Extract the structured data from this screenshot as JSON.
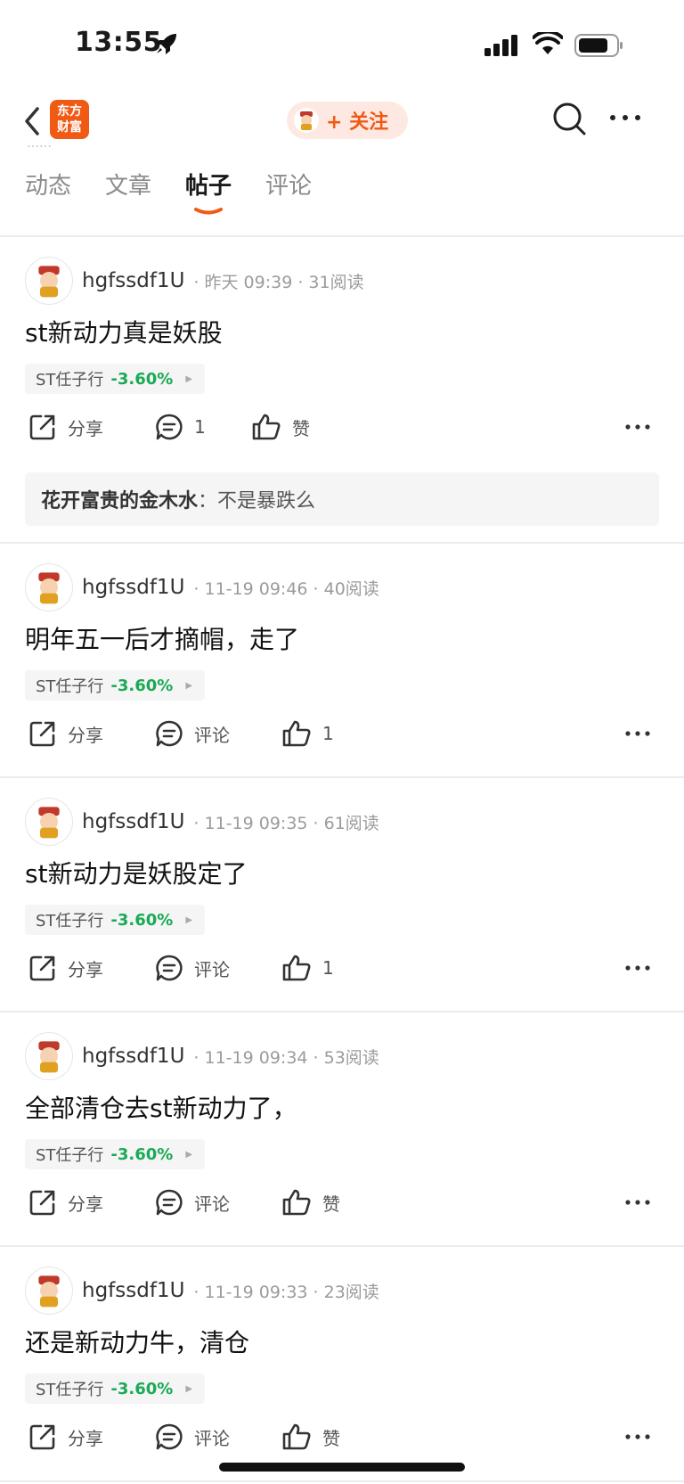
{
  "status_bar": {
    "time": "13:55"
  },
  "nav": {
    "logo_line1": "东方",
    "logo_line2": "财富",
    "follow_label": "+ 关注"
  },
  "peek_text": "……",
  "tabs": [
    {
      "label": "动态"
    },
    {
      "label": "文章"
    },
    {
      "label": "帖子"
    },
    {
      "label": "评论"
    }
  ],
  "posts": [
    {
      "author": "hgfssdf1U",
      "meta": "· 昨天 09:39 · 31阅读",
      "text": "st新动力真是妖股",
      "stock": {
        "name": "ST任子行",
        "change": "-3.60%"
      },
      "share": "分享",
      "comment": "1",
      "like": "赞",
      "reply": {
        "author": "花开富贵的金木水",
        "sep": "：",
        "text": "不是暴跌么"
      }
    },
    {
      "author": "hgfssdf1U",
      "meta": "· 11-19 09:46 · 40阅读",
      "text": "明年五一后才摘帽，走了",
      "stock": {
        "name": "ST任子行",
        "change": "-3.60%"
      },
      "share": "分享",
      "comment": "评论",
      "like": "1"
    },
    {
      "author": "hgfssdf1U",
      "meta": "· 11-19 09:35 · 61阅读",
      "text": "st新动力是妖股定了",
      "stock": {
        "name": "ST任子行",
        "change": "-3.60%"
      },
      "share": "分享",
      "comment": "评论",
      "like": "1"
    },
    {
      "author": "hgfssdf1U",
      "meta": "· 11-19 09:34 · 53阅读",
      "text": "全部清仓去st新动力了，",
      "stock": {
        "name": "ST任子行",
        "change": "-3.60%"
      },
      "share": "分享",
      "comment": "评论",
      "like": "赞"
    },
    {
      "author": "hgfssdf1U",
      "meta": "· 11-19 09:33 · 23阅读",
      "text": "还是新动力牛，清仓",
      "stock": {
        "name": "ST任子行",
        "change": "-3.60%"
      },
      "share": "分享",
      "comment": "评论",
      "like": "赞"
    }
  ],
  "colors": {
    "accent": "#f05a14",
    "stock_down": "#1aaa55"
  }
}
